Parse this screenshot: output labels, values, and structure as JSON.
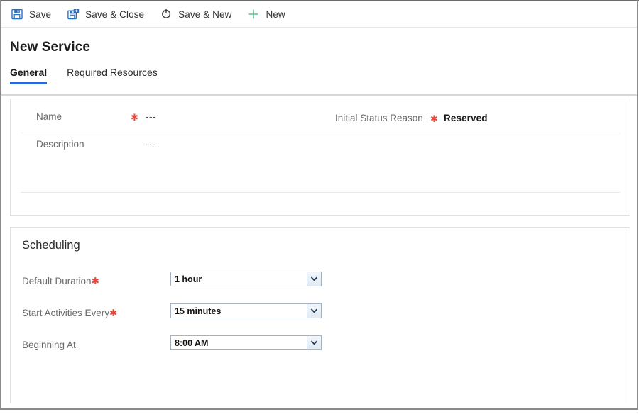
{
  "window": {
    "accent_blue": "#2a66dd",
    "required_red": "#e8483c"
  },
  "toolbar": {
    "buttons": [
      {
        "label": "Save",
        "icon": "save-icon"
      },
      {
        "label": "Save & Close",
        "icon": "save-and-close-icon"
      },
      {
        "label": "Save & New",
        "icon": "save-and-new-icon"
      },
      {
        "label": "New",
        "icon": "plus-icon"
      }
    ]
  },
  "header": {
    "title": "New Service",
    "tabs": [
      {
        "label": "General",
        "active": true
      },
      {
        "label": "Required Resources",
        "active": false
      }
    ]
  },
  "general": {
    "fields": [
      {
        "label": "Name",
        "required": true,
        "value": "---",
        "strong": false
      },
      {
        "label": "Description",
        "required": false,
        "value": "---",
        "strong": false
      }
    ],
    "right_fields": [
      {
        "label": "Initial Status Reason",
        "required": true,
        "value": "Reserved",
        "strong": true
      }
    ]
  },
  "scheduling": {
    "heading": "Scheduling",
    "rows": [
      {
        "label": "Default Duration",
        "required": true,
        "value": "1 hour"
      },
      {
        "label": "Start Activities Every",
        "required": true,
        "value": "15 minutes"
      },
      {
        "label": "Beginning At",
        "required": false,
        "value": "8:00 AM"
      }
    ]
  }
}
